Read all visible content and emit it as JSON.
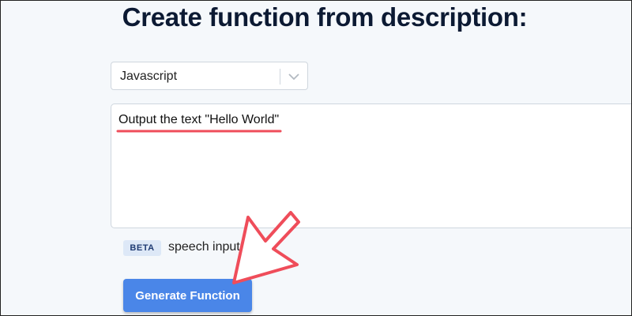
{
  "page": {
    "title": "Create function from description:"
  },
  "language_select": {
    "selected": "Javascript",
    "icon": "chevron-down-icon"
  },
  "description": {
    "value": "Output the text \"Hello World\""
  },
  "speech": {
    "badge": "BETA",
    "label": "speech input:"
  },
  "actions": {
    "generate_label": "Generate Function"
  },
  "colors": {
    "accent": "#4a86e8",
    "annotation": "#ef4d5a",
    "title": "#0c1a33",
    "badge_bg": "#dde8f7"
  }
}
